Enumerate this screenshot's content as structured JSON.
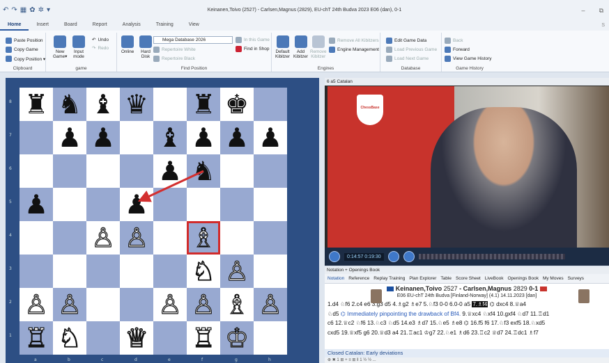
{
  "window": {
    "title": "Keinanen,Toivo (2527) - Carlsen,Magnus (2829), EU-chT 24th Budva 2023  E06  (dan), 0-1",
    "min": "–",
    "restore": "⧉",
    "qat": [
      "↶",
      "↷",
      "▦",
      "✿",
      "✲",
      "▾"
    ]
  },
  "tabs": [
    "Home",
    "Insert",
    "Board",
    "Report",
    "Analysis",
    "Training",
    "View"
  ],
  "tabs_right": "S",
  "ribbon": {
    "clipboard": {
      "items": [
        "Paste Position",
        "Copy Game",
        "Copy Position ▾"
      ],
      "label": "Clipboard"
    },
    "game": {
      "new": "New\nGame▾",
      "input": "Input\nmode",
      "undo": "Undo",
      "redo": "Redo",
      "label": "game"
    },
    "find": {
      "online": "Online",
      "hard": "Hard\nDisk",
      "db": "Mega Database 2026",
      "in_this_game": "In this Game",
      "find_in_shop": "Find in Shop",
      "rep_white": "Repertoire White",
      "rep_black": "Repertoire Black",
      "label": "Find Position"
    },
    "engines": {
      "default": "Default\nKibitzer",
      "add": "Add\nKibitzer",
      "remove": "Remove\nKibitzer",
      "remove_all": "Remove All Kibitzers",
      "mgmt": "Engine Management",
      "label": "Engines"
    },
    "database": {
      "edit": "Edit Game Data",
      "prev": "Load Previous Game",
      "next": "Load Next Game",
      "label": "Database"
    },
    "history": {
      "back": "Back",
      "forward": "Forward",
      "view": "View Game History",
      "label": "Game History"
    }
  },
  "board": {
    "ranks": [
      "8",
      "7",
      "6",
      "5",
      "4",
      "3",
      "2",
      "1"
    ],
    "files": [
      "a",
      "b",
      "c",
      "d",
      "e",
      "f",
      "g",
      "h"
    ],
    "rows": [
      [
        "♜",
        "♞",
        "♝",
        "♛",
        "",
        "♜",
        "♚",
        ""
      ],
      [
        "",
        "♟",
        "♟",
        "",
        "♝",
        "♟",
        "♟",
        "♟"
      ],
      [
        "",
        "",
        "",
        "",
        "♟",
        "♞",
        "",
        ""
      ],
      [
        "♟",
        "",
        "",
        "♟",
        "",
        "",
        "",
        ""
      ],
      [
        "",
        "",
        "♙",
        "♙",
        "",
        "♗",
        "",
        ""
      ],
      [
        "",
        "",
        "",
        "",
        "",
        "♘",
        "♙",
        ""
      ],
      [
        "♙",
        "♙",
        "",
        "",
        "♙",
        "♙",
        "♗",
        "♙"
      ],
      [
        "♖",
        "♘",
        "",
        "♕",
        "",
        "♖",
        "♔",
        ""
      ]
    ],
    "highlight": "f4",
    "arrow": {
      "from": "f6",
      "to": "d5",
      "color": "#d32f2f"
    }
  },
  "video": {
    "title": "6 a5 Catalan",
    "time": "0:14:57 0:19:30",
    "logo": "ChessBase"
  },
  "notation": {
    "header": "Notation + Openings Book",
    "tabs": [
      "Notation",
      "Reference",
      "Replay Training",
      "Plan Explorer",
      "Table",
      "Score Sheet",
      "LiveBook",
      "Openings Book",
      "My Moves",
      "Surveys"
    ],
    "white": "Keinanen,Toivo",
    "white_elo": "2527",
    "sep": "-",
    "black": "Carlsen,Magnus",
    "black_elo": "2829",
    "result": "0-1",
    "event": "E06 EU-chT 24th Budva [Finland-Norway] (4.1) 14.11.2023 [dan]",
    "line1": "1.d4 ♘f6 2.c4 e6 3.g3 d5 4.♗g2 ♗e7 5.♘f3 0-0 6.0-0 a5",
    "current": "7.♗f4",
    "line1b": "dxc4 8.♕a4",
    "line2a": "♘d5",
    "comment": "Immediately pinpointing the drawback of Bf4.",
    "line2b": "9.♕xc4 ♘xf4 10.gxf4 ♘d7 11.♖d1",
    "line3": "c6 12.♕c2 ♘f6 13.♘c3 ♘d5 14.e3 ♗d7 15.♘e5 ♗e8 ⌬ 16.f5 f6 17.♘f3 exf5 18.♘xd5",
    "line4": "cxd5 19.♕xf5 g6 20.♕d3 a4 21.♖ac1 ♔g7 22.♘e1 ♗d6 23.♖c2 ♕d7 24.♖dc1 ♗f7",
    "opening": "Closed Catalan: Early deviations",
    "strip": "⊕  ✖  1  ⊞  +  ≡  ⊞  ‖  1  ½  ½ ..."
  }
}
